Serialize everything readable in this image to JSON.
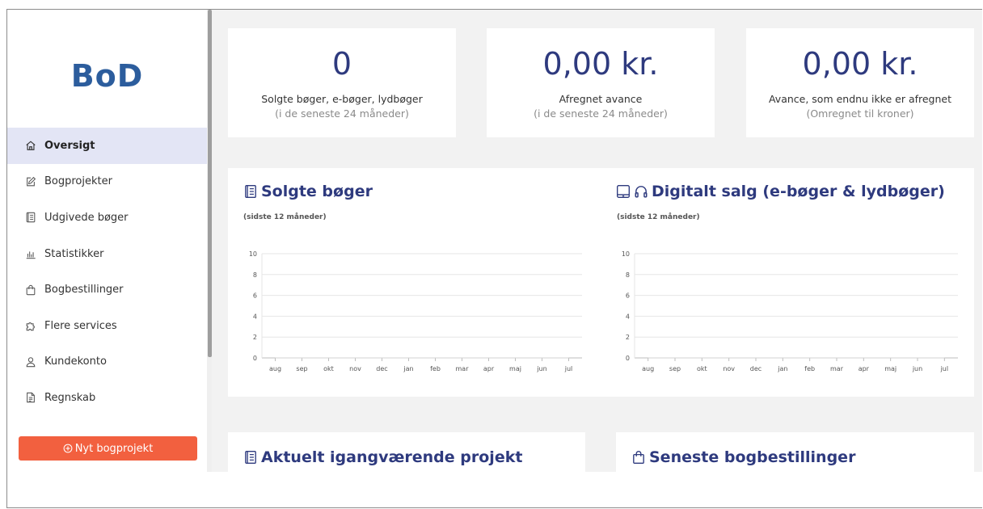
{
  "brand": {
    "logo": "BoD",
    "color": "#2c5d9d"
  },
  "sidebar": {
    "items": [
      {
        "label": "Oversigt",
        "icon": "home-icon",
        "active": true
      },
      {
        "label": "Bogprojekter",
        "icon": "edit-icon"
      },
      {
        "label": "Udgivede bøger",
        "icon": "book-icon"
      },
      {
        "label": "Statistikker",
        "icon": "bar-chart-icon"
      },
      {
        "label": "Bogbestillinger",
        "icon": "shopping-bag-icon"
      },
      {
        "label": "Flere services",
        "icon": "puzzle-icon"
      },
      {
        "label": "Kundekonto",
        "icon": "user-icon"
      },
      {
        "label": "Regnskab",
        "icon": "document-icon"
      }
    ],
    "new_project_label": "Nyt bogprojekt",
    "new_project_color": "#f2603f"
  },
  "stats": [
    {
      "value": "0",
      "label": "Solgte bøger, e-bøger, lydbøger",
      "sub": "(i de seneste 24 måneder)"
    },
    {
      "value": "0,00 kr.",
      "label": "Afregnet avance",
      "sub": "(i de seneste 24 måneder)"
    },
    {
      "value": "0,00 kr.",
      "label": "Avance, som endnu ikke er afregnet",
      "sub": "(Omregnet til kroner)"
    }
  ],
  "sections": {
    "sold_books": {
      "title": "Solgte bøger",
      "subtitle": "(sidste 12 måneder)"
    },
    "digital_sales": {
      "title": "Digitalt salg (e-bøger & lydbøger)",
      "subtitle": "(sidste 12 måneder)"
    },
    "current_project": {
      "title": "Aktuelt igangværende projekt"
    },
    "latest_orders": {
      "title": "Seneste bogbestillinger"
    }
  },
  "chart_data": [
    {
      "type": "line",
      "categories": [
        "aug",
        "sep",
        "okt",
        "nov",
        "dec",
        "jan",
        "feb",
        "mar",
        "apr",
        "maj",
        "jun",
        "jul"
      ],
      "series": [
        {
          "values": [
            0,
            0,
            0,
            0,
            0,
            0,
            0,
            0,
            0,
            0,
            0,
            0
          ]
        }
      ],
      "yticks": [
        0,
        2,
        4,
        6,
        8,
        10
      ],
      "ylim": [
        0,
        10
      ],
      "grid": true
    },
    {
      "type": "line",
      "categories": [
        "aug",
        "sep",
        "okt",
        "nov",
        "dec",
        "jan",
        "feb",
        "mar",
        "apr",
        "maj",
        "jun",
        "jul"
      ],
      "series": [
        {
          "values": [
            0,
            0,
            0,
            0,
            0,
            0,
            0,
            0,
            0,
            0,
            0,
            0
          ]
        }
      ],
      "yticks": [
        0,
        2,
        4,
        6,
        8,
        10
      ],
      "ylim": [
        0,
        10
      ],
      "grid": true
    }
  ],
  "colors": {
    "accent": "#2e3a7e",
    "active_bg": "#e3e5f5",
    "content_bg": "#f2f2f2"
  }
}
